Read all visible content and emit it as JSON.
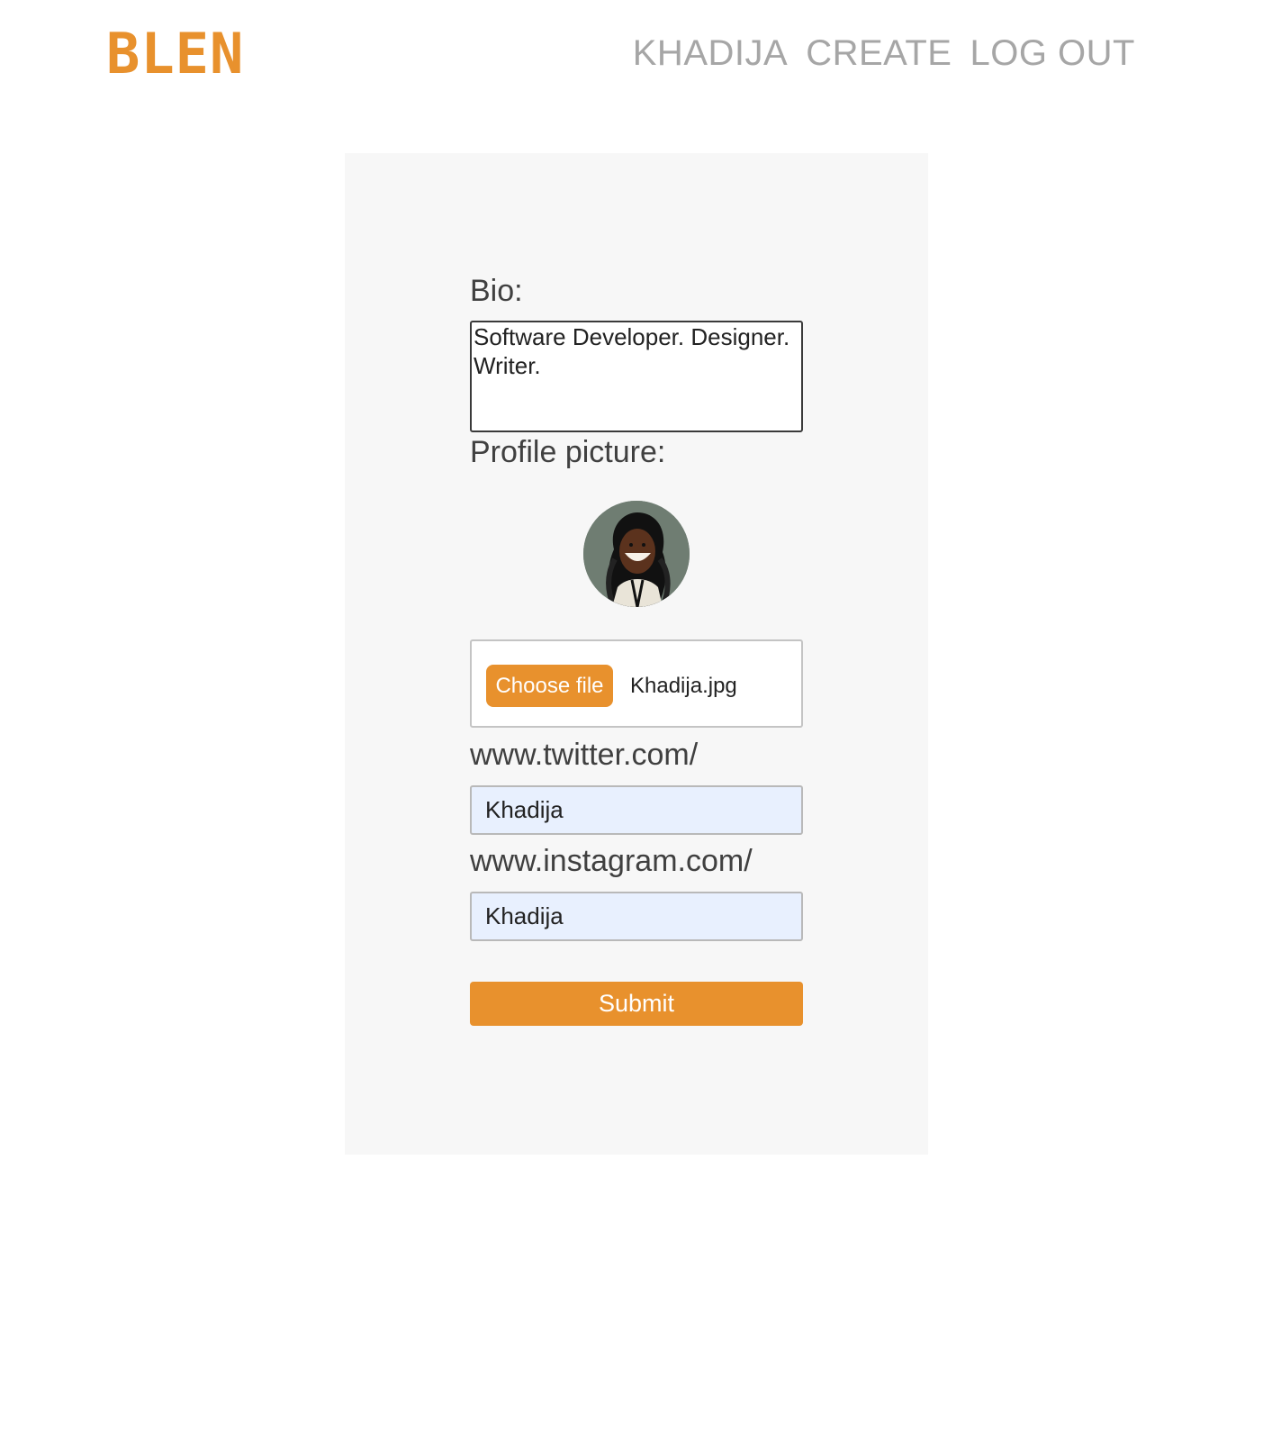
{
  "header": {
    "logo": "BLEN",
    "nav": [
      "KHADIJA",
      "CREATE",
      "LOG OUT"
    ]
  },
  "form": {
    "bio_label": "Bio:",
    "bio_value": "Software Developer. Designer. Writer.",
    "profile_picture_label": "Profile picture:",
    "choose_file_label": "Choose file",
    "file_name": "Khadija.jpg",
    "twitter_label": "www.twitter.com/",
    "twitter_value": "Khadija",
    "instagram_label": "www.instagram.com/",
    "instagram_value": "Khadija",
    "submit_label": "Submit"
  },
  "colors": {
    "accent": "#e8912d",
    "panel_background": "#f7f7f7",
    "autofill_input": "#e8f0fe",
    "nav_text": "#a6a6a6"
  },
  "icons": {
    "avatar": "profile-photo-avatar",
    "textarea_resize": "resize-grip-icon"
  }
}
